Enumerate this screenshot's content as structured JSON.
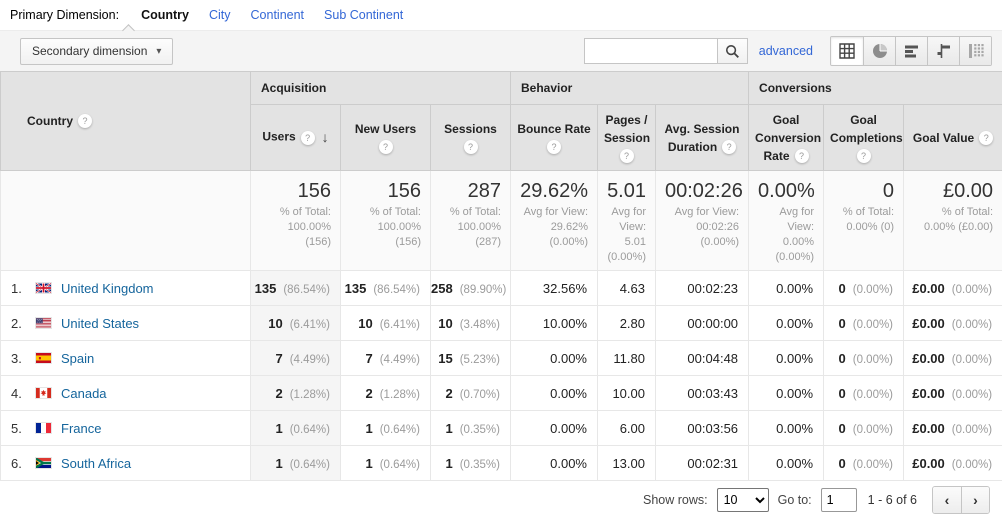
{
  "colors": {
    "link_blue": "#15659c",
    "tab_blue": "#3367d6",
    "header_bg": "#e3e3e3",
    "sorted_col_bg": "#f5f5f5"
  },
  "icons": {
    "help": "?",
    "sort_desc": "↓",
    "caret_down": "▾"
  },
  "primary_dimension": {
    "label": "Primary Dimension:",
    "tabs": [
      {
        "label": "Country",
        "selected": true
      },
      {
        "label": "City",
        "selected": false
      },
      {
        "label": "Continent",
        "selected": false
      },
      {
        "label": "Sub Continent",
        "selected": false
      }
    ]
  },
  "toolbar": {
    "secondary_dimension_label": "Secondary dimension",
    "search_value": "",
    "search_placeholder": "",
    "advanced_label": "advanced",
    "view_buttons": [
      "table-view",
      "percentage-view",
      "performance-view",
      "comparison-view",
      "pivot-view"
    ],
    "active_view": "table-view"
  },
  "table": {
    "dimension_header": "Country",
    "groups": {
      "acquisition": "Acquisition",
      "behavior": "Behavior",
      "conversions": "Conversions"
    },
    "columns": {
      "users": "Users",
      "new_users": "New Users",
      "sessions": "Sessions",
      "bounce_rate": "Bounce Rate",
      "pages_session": "Pages / Session",
      "avg_duration": "Avg. Session Duration",
      "goal_conv_rate": "Goal Conversion Rate",
      "goal_completions": "Goal Completions",
      "goal_value": "Goal Value"
    },
    "sorted_column": "users",
    "summary": {
      "users": {
        "value": "156",
        "sub": "% of Total: 100.00% (156)"
      },
      "new_users": {
        "value": "156",
        "sub": "% of Total: 100.00% (156)"
      },
      "sessions": {
        "value": "287",
        "sub": "% of Total: 100.00% (287)"
      },
      "bounce_rate": {
        "value": "29.62%",
        "sub": "Avg for View: 29.62% (0.00%)"
      },
      "pages_session": {
        "value": "5.01",
        "sub": "Avg for View: 5.01 (0.00%)"
      },
      "avg_duration": {
        "value": "00:02:26",
        "sub": "Avg for View: 00:02:26 (0.00%)"
      },
      "goal_conv_rate": {
        "value": "0.00%",
        "sub": "Avg for View: 0.00% (0.00%)"
      },
      "goal_completions": {
        "value": "0",
        "sub": "% of Total: 0.00% (0)"
      },
      "goal_value": {
        "value": "£0.00",
        "sub": "% of Total: 0.00% (£0.00)"
      }
    },
    "rows": [
      {
        "rank": "1.",
        "flag": "gb",
        "country": "United Kingdom",
        "users": [
          "135",
          "(86.54%)"
        ],
        "new_users": [
          "135",
          "(86.54%)"
        ],
        "sessions": [
          "258",
          "(89.90%)"
        ],
        "bounce_rate": "32.56%",
        "pages_session": "4.63",
        "avg_duration": "00:02:23",
        "goal_conv_rate": "0.00%",
        "goal_completions": [
          "0",
          "(0.00%)"
        ],
        "goal_value": [
          "£0.00",
          "(0.00%)"
        ]
      },
      {
        "rank": "2.",
        "flag": "us",
        "country": "United States",
        "users": [
          "10",
          "(6.41%)"
        ],
        "new_users": [
          "10",
          "(6.41%)"
        ],
        "sessions": [
          "10",
          "(3.48%)"
        ],
        "bounce_rate": "10.00%",
        "pages_session": "2.80",
        "avg_duration": "00:00:00",
        "goal_conv_rate": "0.00%",
        "goal_completions": [
          "0",
          "(0.00%)"
        ],
        "goal_value": [
          "£0.00",
          "(0.00%)"
        ]
      },
      {
        "rank": "3.",
        "flag": "es",
        "country": "Spain",
        "users": [
          "7",
          "(4.49%)"
        ],
        "new_users": [
          "7",
          "(4.49%)"
        ],
        "sessions": [
          "15",
          "(5.23%)"
        ],
        "bounce_rate": "0.00%",
        "pages_session": "11.80",
        "avg_duration": "00:04:48",
        "goal_conv_rate": "0.00%",
        "goal_completions": [
          "0",
          "(0.00%)"
        ],
        "goal_value": [
          "£0.00",
          "(0.00%)"
        ]
      },
      {
        "rank": "4.",
        "flag": "ca",
        "country": "Canada",
        "users": [
          "2",
          "(1.28%)"
        ],
        "new_users": [
          "2",
          "(1.28%)"
        ],
        "sessions": [
          "2",
          "(0.70%)"
        ],
        "bounce_rate": "0.00%",
        "pages_session": "10.00",
        "avg_duration": "00:03:43",
        "goal_conv_rate": "0.00%",
        "goal_completions": [
          "0",
          "(0.00%)"
        ],
        "goal_value": [
          "£0.00",
          "(0.00%)"
        ]
      },
      {
        "rank": "5.",
        "flag": "fr",
        "country": "France",
        "users": [
          "1",
          "(0.64%)"
        ],
        "new_users": [
          "1",
          "(0.64%)"
        ],
        "sessions": [
          "1",
          "(0.35%)"
        ],
        "bounce_rate": "0.00%",
        "pages_session": "6.00",
        "avg_duration": "00:03:56",
        "goal_conv_rate": "0.00%",
        "goal_completions": [
          "0",
          "(0.00%)"
        ],
        "goal_value": [
          "£0.00",
          "(0.00%)"
        ]
      },
      {
        "rank": "6.",
        "flag": "za",
        "country": "South Africa",
        "users": [
          "1",
          "(0.64%)"
        ],
        "new_users": [
          "1",
          "(0.64%)"
        ],
        "sessions": [
          "1",
          "(0.35%)"
        ],
        "bounce_rate": "0.00%",
        "pages_session": "13.00",
        "avg_duration": "00:02:31",
        "goal_conv_rate": "0.00%",
        "goal_completions": [
          "0",
          "(0.00%)"
        ],
        "goal_value": [
          "£0.00",
          "(0.00%)"
        ]
      }
    ]
  },
  "footer": {
    "show_rows_label": "Show rows:",
    "show_rows_value": "10",
    "goto_label": "Go to:",
    "goto_value": "1",
    "range_text": "1 - 6 of 6",
    "prev_icon": "‹",
    "next_icon": "›"
  }
}
